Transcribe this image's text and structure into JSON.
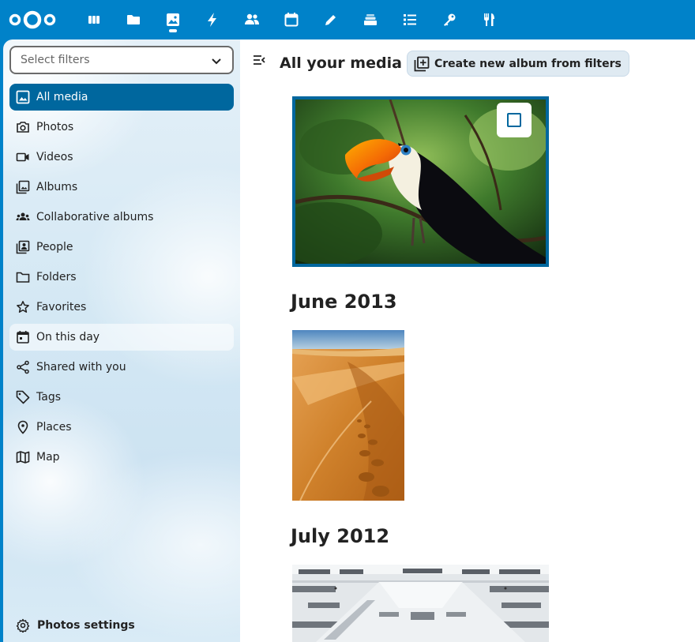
{
  "header": {
    "logo": "nextcloud-logo",
    "apps": [
      {
        "id": "dashboard",
        "icon": "dashboard-icon"
      },
      {
        "id": "files",
        "icon": "folder-icon"
      },
      {
        "id": "photos",
        "icon": "image-icon",
        "active": true
      },
      {
        "id": "activity",
        "icon": "lightning-icon"
      },
      {
        "id": "contacts",
        "icon": "contacts-icon"
      },
      {
        "id": "calendar",
        "icon": "calendar-icon"
      },
      {
        "id": "notes",
        "icon": "pencil-icon"
      },
      {
        "id": "deck",
        "icon": "deck-icon"
      },
      {
        "id": "tasks",
        "icon": "checklist-icon"
      },
      {
        "id": "passwords",
        "icon": "key-icon"
      },
      {
        "id": "cookbook",
        "icon": "cutlery-icon"
      }
    ]
  },
  "sidebar": {
    "filter_placeholder": "Select filters",
    "items": [
      {
        "label": "All media",
        "icon": "image-icon",
        "active": true
      },
      {
        "label": "Photos",
        "icon": "camera-icon"
      },
      {
        "label": "Videos",
        "icon": "video-icon"
      },
      {
        "label": "Albums",
        "icon": "album-icon"
      },
      {
        "label": "Collaborative albums",
        "icon": "group-icon"
      },
      {
        "label": "People",
        "icon": "person-icon"
      },
      {
        "label": "Folders",
        "icon": "folder-icon"
      },
      {
        "label": "Favorites",
        "icon": "star-icon"
      },
      {
        "label": "On this day",
        "icon": "calendar-day-icon",
        "hover": true
      },
      {
        "label": "Shared with you",
        "icon": "share-icon"
      },
      {
        "label": "Tags",
        "icon": "tag-icon"
      },
      {
        "label": "Places",
        "icon": "map-pin-icon"
      },
      {
        "label": "Map",
        "icon": "map-icon"
      }
    ],
    "settings_label": "Photos settings"
  },
  "main": {
    "title": "All your media",
    "create_album_label": "Create new album from filters",
    "months": [
      "June 2013",
      "July 2012"
    ]
  },
  "colors": {
    "primary": "#0082c9",
    "active": "#00679e"
  }
}
